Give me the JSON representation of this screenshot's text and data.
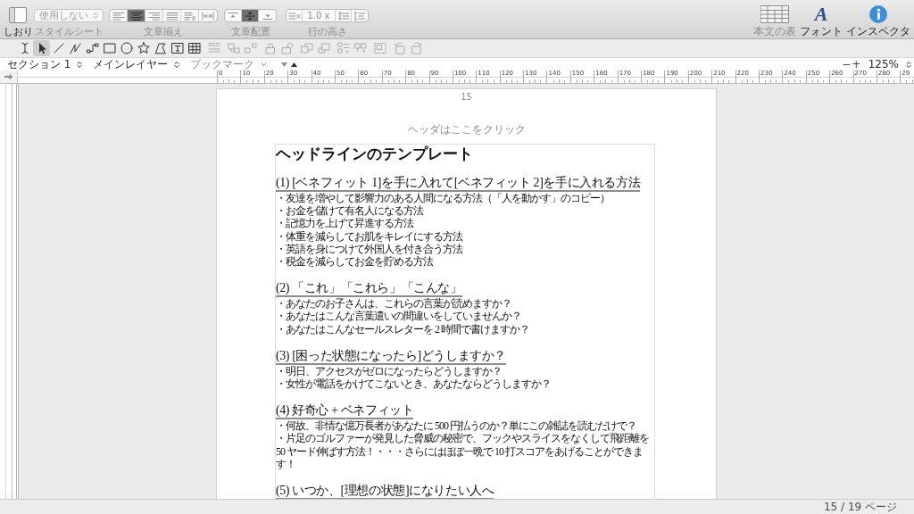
{
  "toolbar": {
    "sidebar_button": {
      "label": "しおり"
    },
    "style_sheet": {
      "value": "使用しない",
      "label": "スタイルシート",
      "disabled": true
    },
    "text_alignment": {
      "label": "文章揃え",
      "disabled": true,
      "options": [
        {
          "kind": "left",
          "selected": false
        },
        {
          "kind": "center",
          "selected": true
        },
        {
          "kind": "right",
          "selected": false
        },
        {
          "kind": "justify",
          "selected": false
        },
        {
          "kind": "natural",
          "selected": false
        },
        {
          "kind": "fit",
          "selected": false
        }
      ]
    },
    "vertical_alignment": {
      "label": "文章配置",
      "disabled": true,
      "options": [
        {
          "kind": "top",
          "selected": false
        },
        {
          "kind": "middle",
          "selected": true
        },
        {
          "kind": "bottom",
          "selected": false
        }
      ]
    },
    "line_height": {
      "label": "行の高さ",
      "disabled": true,
      "value": "1.0 x"
    },
    "right_buttons": [
      {
        "kind": "table",
        "label": "本文の表",
        "disabled": true
      },
      {
        "kind": "font",
        "glyph": "A",
        "label": "フォント",
        "disabled": false
      },
      {
        "kind": "inspector",
        "label": "インスペクタ",
        "disabled": false
      }
    ]
  },
  "tool_groups": [
    {
      "tools": [
        {
          "kind": "text",
          "selected": false,
          "disabled": false
        },
        {
          "kind": "select",
          "selected": true,
          "disabled": false
        },
        {
          "kind": "line",
          "selected": false,
          "disabled": false
        },
        {
          "kind": "polyline",
          "selected": false,
          "disabled": false
        },
        {
          "kind": "connector",
          "selected": false,
          "disabled": false
        },
        {
          "kind": "rectangle",
          "selected": false,
          "disabled": false
        },
        {
          "kind": "ellipse",
          "selected": false,
          "disabled": false
        },
        {
          "kind": "star",
          "selected": false,
          "disabled": false
        },
        {
          "kind": "polygon",
          "selected": false,
          "disabled": false
        },
        {
          "kind": "text-box",
          "selected": false,
          "disabled": false
        },
        {
          "kind": "table",
          "selected": false,
          "disabled": false
        }
      ]
    },
    {
      "tools": [
        {
          "kind": "align",
          "selected": false,
          "disabled": true
        }
      ]
    },
    {
      "tools": [
        {
          "kind": "group",
          "selected": false,
          "disabled": true
        },
        {
          "kind": "ungroup",
          "selected": false,
          "disabled": true
        }
      ]
    },
    {
      "tools": [
        {
          "kind": "lock",
          "selected": false,
          "disabled": true
        },
        {
          "kind": "unlock",
          "selected": false,
          "disabled": true
        }
      ]
    },
    {
      "tools": [
        {
          "kind": "front",
          "selected": false,
          "disabled": true
        },
        {
          "kind": "back",
          "selected": false,
          "disabled": true
        }
      ]
    },
    {
      "tools": [
        {
          "kind": "arrange",
          "selected": false,
          "disabled": true
        },
        {
          "kind": "distribute",
          "selected": false,
          "disabled": true
        }
      ]
    },
    {
      "tools": [
        {
          "kind": "image-frame",
          "selected": false,
          "disabled": true
        }
      ]
    },
    {
      "tools": [
        {
          "kind": "rotate-left",
          "selected": false,
          "disabled": true
        },
        {
          "kind": "rotate-right",
          "selected": false,
          "disabled": true
        }
      ]
    }
  ],
  "navigation": {
    "section": "セクション 1",
    "layer": "メインレイヤー",
    "bookmark": {
      "label": "ブックマーク",
      "disabled": true
    },
    "page_buttons": [
      {
        "kind": "down",
        "disabled": true
      },
      {
        "kind": "up",
        "disabled": false
      }
    ],
    "zoom_out": "−",
    "zoom_in": "+",
    "zoom": "125%"
  },
  "ruler": {
    "numbers": [
      "0",
      "10",
      "20",
      "30",
      "40",
      "50",
      "60",
      "70",
      "80",
      "90",
      "100",
      "110",
      "120",
      "130",
      "140",
      "150",
      "160",
      "170",
      "180",
      "190",
      "200",
      "210",
      "220",
      "230",
      "240",
      "250",
      "260",
      "270",
      "280",
      "29"
    ]
  },
  "document": {
    "page_number": "15",
    "header_placeholder": "ヘッダはここをクリック",
    "title": "ヘッドラインのテンプレート",
    "sections": [
      {
        "heading": "(1) [ベネフィット 1]を手に入れて[ベネフィット 2]を手に入れる方法",
        "items": [
          "・友達を増やして影響力のある人間になる方法（「人を動かす」のコピー）",
          "・お金を儲けて有名人になる方法",
          "・記憶力を上げて昇進する方法",
          "・体重を減らしてお肌をキレイにする方法",
          "・英語を身につけて外国人を付き合う方法",
          "・税金を減らしてお金を貯める方法"
        ]
      },
      {
        "heading": "(2) 「これ」「これら」「こんな」",
        "items": [
          "・あなたのお子さんは、これらの言葉が読めますか？",
          "・あなたはこんな言葉遣いの間違いをしていませんか？",
          "・あなたはこんなセールスレターを 2 時間で書けますか？"
        ]
      },
      {
        "heading": "(3) [困った状態になったら]どうしますか？",
        "items": [
          "・明日、アクセスがゼロになったらどうしますか？",
          "・女性が電話をかけてこないとき、あなたならどうしますか？"
        ]
      },
      {
        "heading": "(4) 好奇心 + ベネフィット",
        "items": [
          "・何故、非情な億万長者があなたに 500 円払うのか？単にこの雑誌を読むだけで？",
          "・片足のゴルファーが発見した脅威の秘密で、フックやスライスをなくして飛距離を 50 ヤード伸ばす方法！・・・さらにはほぼ一晩で 10 打スコアをあげることができます！"
        ]
      },
      {
        "heading": "(5) いつか、[理想の状態]になりたい人へ"
      }
    ]
  },
  "status_bar": {
    "page_count": "15 / 19 ページ"
  }
}
